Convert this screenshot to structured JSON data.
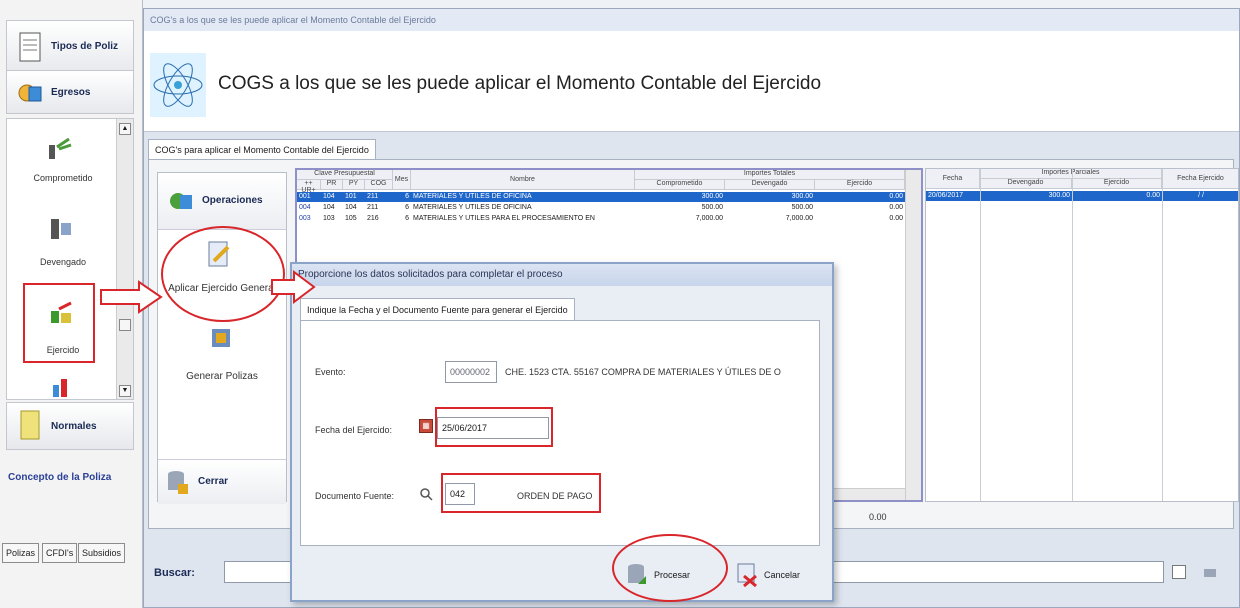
{
  "nav": {
    "top_button": "Tipos de Poliz",
    "egresos": "Egresos",
    "items": [
      "Comprometido",
      "Devengado",
      "Ejercido"
    ],
    "normales": "Normales",
    "concepto": "Concepto de la Poliza",
    "tabs": [
      "Polizas",
      "CFDI's",
      "Subsidios"
    ]
  },
  "window": {
    "titlebar": "COG's a los que se les puede aplicar el Momento Contable del Ejercido",
    "header_title": "COGS a los que se les puede aplicar el Momento Contable del Ejercido",
    "tab": "COG's para aplicar el Momento Contable del Ejercido"
  },
  "ops": {
    "title": "Operaciones",
    "aplicar": "Aplicar Ejercido General",
    "generar": "Generar Polizas",
    "cerrar": "Cerrar"
  },
  "grid": {
    "group_clave": "Clave Presupuestal",
    "group_importes": "Importes Totales",
    "col_cog": "++ UR+",
    "col_pr": "PR",
    "col_py": "PY",
    "col_cog2": "COG",
    "col_mes": "Mes",
    "col_nombre": "Nombre",
    "col_comprometido": "Comprometido",
    "col_devengado": "Devengado",
    "col_ejercido": "Ejercido",
    "rows": [
      {
        "ur": "001",
        "pr": "104",
        "py": "101",
        "cog": "211",
        "mes": "6",
        "nombre": "MATERIALES Y UTILES DE OFICINA",
        "comp": "300.00",
        "dev": "300.00",
        "ejer": "0.00"
      },
      {
        "ur": "004",
        "pr": "104",
        "py": "104",
        "cog": "211",
        "mes": "6",
        "nombre": "MATERIALES Y UTILES DE OFICINA",
        "comp": "500.00",
        "dev": "500.00",
        "ejer": "0.00"
      },
      {
        "ur": "003",
        "pr": "103",
        "py": "105",
        "cog": "216",
        "mes": "6",
        "nombre": "MATERIALES Y UTILES PARA EL PROCESAMIENTO EN",
        "comp": "7,000.00",
        "dev": "7,000.00",
        "ejer": "0.00"
      }
    ]
  },
  "grid2": {
    "col_fecha": "Fecha",
    "group": "Importes Parciales",
    "col_devengado": "Devengado",
    "col_ejercido": "Ejercido",
    "col_fecha_ejercido": "Fecha Ejercido",
    "row": {
      "fecha": "20/06/2017",
      "dev": "300.00",
      "ejer": "0.00",
      "fecha_ej": "/ /"
    }
  },
  "footer": {
    "total": "0.00",
    "buscar": "Buscar:"
  },
  "dialog": {
    "title": "Proporcione los datos solicitados para completar el proceso",
    "tab": "Indique la Fecha y el Documento Fuente para generar el Ejercido",
    "evento_label": "Evento:",
    "evento_id": "00000002",
    "evento_desc": "CHE. 1523 CTA. 55167 COMPRA DE MATERIALES Y ÚTILES DE O",
    "fecha_label": "Fecha del Ejercido:",
    "fecha_value": "25/06/2017",
    "doc_label": "Documento Fuente:",
    "doc_code": "042",
    "doc_desc": "ORDEN DE PAGO",
    "procesar": "Procesar",
    "cancelar": "Cancelar"
  }
}
